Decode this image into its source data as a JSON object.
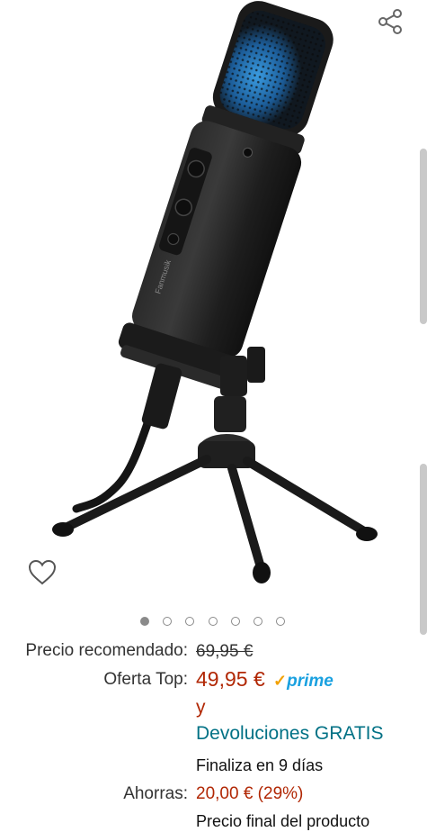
{
  "product_image": {
    "brand_print": "Fanmusik",
    "alt": "microphone"
  },
  "actions": {
    "share_icon": "share-icon",
    "wishlist_icon": "heart-icon"
  },
  "carousel": {
    "count": 7,
    "active_index": 0
  },
  "pricing": {
    "recommended_label": "Precio recomendado:",
    "recommended_value": "69,95 €",
    "offer_label": "Oferta Top:",
    "offer_price": "49,95 €",
    "prime_check": "✓",
    "prime_word": "prime",
    "and_text": "y",
    "returns_text": "Devoluciones GRATIS",
    "ends_text": "Finaliza en 9 días",
    "savings_label": "Ahorras:",
    "savings_value": "20,00 € (29%)",
    "final_price_text": "Precio final del producto"
  }
}
